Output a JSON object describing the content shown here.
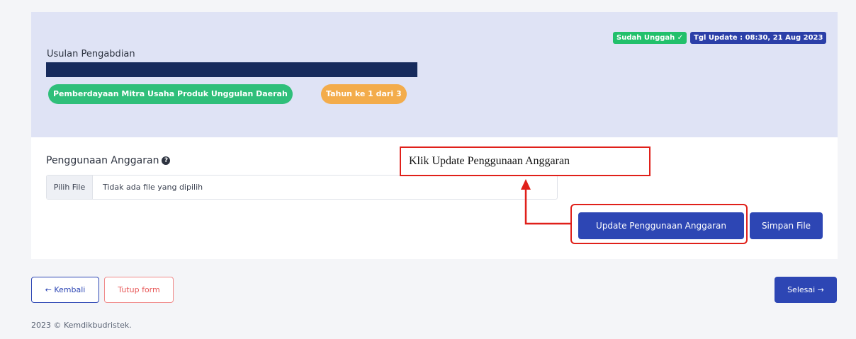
{
  "header": {
    "badge_uploaded": "Sudah Unggah ✓",
    "badge_update": "Tgl Update : 08:30, 21 Aug 2023",
    "proposal_label": "Usulan Pengabdian",
    "pill_scheme": "Pemberdayaan Mitra Usaha Produk Unggulan Daerah",
    "pill_year": "Tahun ke 1 dari 3"
  },
  "form": {
    "section_label": "Penggunaan Anggaran",
    "help_icon": "question-circle-icon",
    "file_button": "Pilih File",
    "file_status": "Tidak ada file yang dipilih",
    "update_button": "Update Penggunaan Anggaran",
    "save_button": "Simpan File"
  },
  "annotation": {
    "callout_text": "Klik Update Penggunaan Anggaran",
    "color": "#e0201a"
  },
  "nav": {
    "back_button": "← Kembali",
    "close_button": "Tutup form",
    "finish_button": "Selesai →"
  },
  "footer": {
    "copyright": "2023 © Kemdikbudristek."
  },
  "colors": {
    "primary": "#2d46b4",
    "success": "#22c06b",
    "warning": "#f3ac4b",
    "header_bg": "#dfe3f5",
    "title_bar": "#172b5c"
  }
}
